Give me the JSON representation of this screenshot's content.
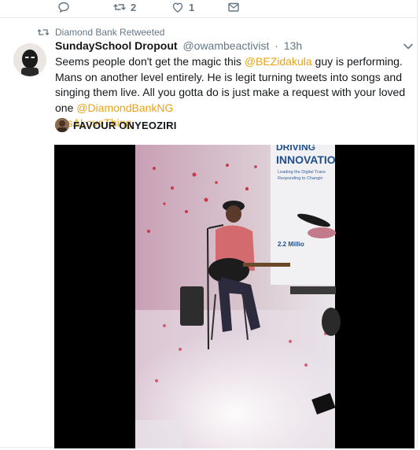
{
  "actions": {
    "reply_count": "",
    "retweet_count": "2",
    "like_count": "1"
  },
  "retweet_context": "Diamond Bank Retweeted",
  "tweet": {
    "display_name": "SundaySchool Dropout",
    "handle": "@owambeactivist",
    "separator": "·",
    "time": "13h",
    "text_1": "Seems people don't get the magic this ",
    "mention_1": "@BEZidakula",
    "text_2": " guy is performing. Mans on another level entirely. He is legit turning tweets into songs and singing them live. All you gotta do is just make a request with your loved one ",
    "mention_2": "@DiamondBankNG",
    "hashtag": "#ItsALoveThing"
  },
  "attribution": {
    "author": "FAVOUR ONYEOZIRI"
  },
  "video": {
    "banner_line1": "DRIVING",
    "banner_line2": "INNOVATIO",
    "banner_sub1": "Leading the Digital Trans",
    "banner_sub2": "Responding to Changin",
    "banner_stat": "2.2 Millio"
  },
  "colors": {
    "link": "#e8a317",
    "secondary": "#657786",
    "border": "#e6ecf0"
  }
}
